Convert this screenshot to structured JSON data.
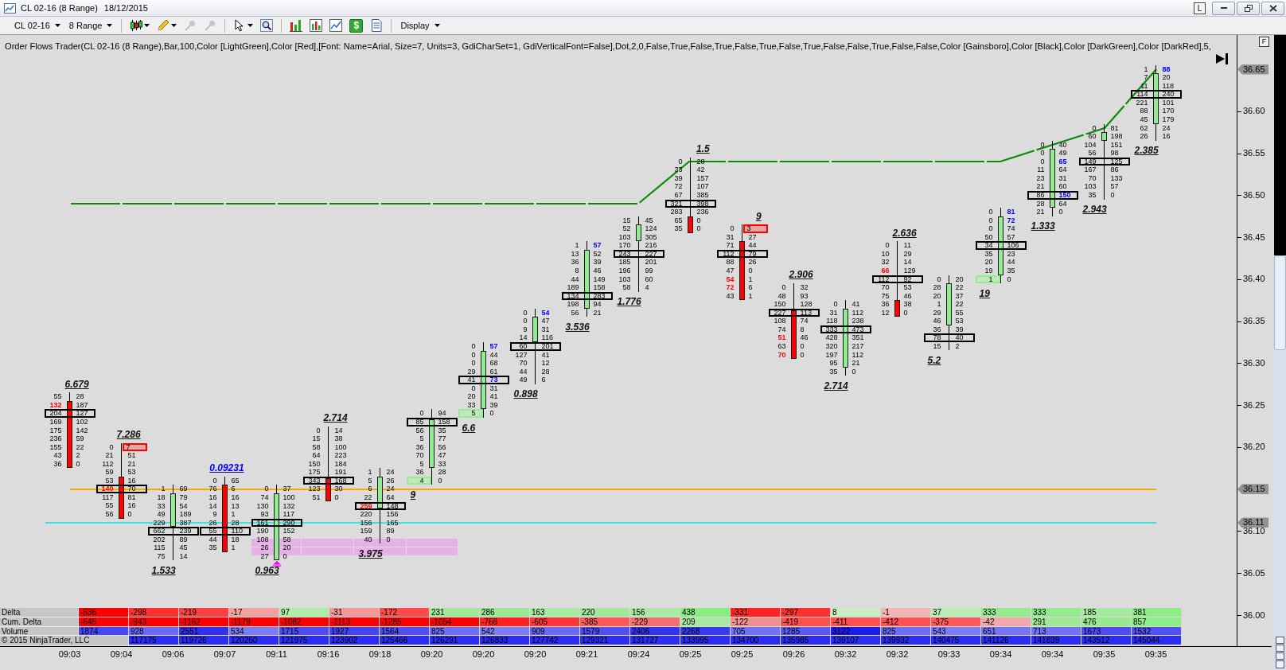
{
  "window": {
    "title": "CL 02-16 (8 Range)",
    "date": "18/12/2015",
    "link_button": "L"
  },
  "toolbar": {
    "instrument": "CL 02-16",
    "period": "8 Range",
    "glyph_button": "$",
    "menu": "Display"
  },
  "indicator": "Order Flows Trader(CL 02-16 (8 Range),Bar,100,Color [LightGreen],Color [Red],[Font: Name=Arial, Size=7, Units=3, GdiCharSet=1, GdiVerticalFont=False],Dot,2,0,False,True,False,True,False,True,False,True,False,False,True,False,False,Color [Gainsboro],Color [Black],Color [DarkGreen],Color [DarkRed],5,",
  "panel_button": "F",
  "bars": [
    {
      "kind": "down",
      "ratio": "6.679",
      "ratio_highlighted": false,
      "marker": false,
      "rows": [
        {
          "bid": "55",
          "ask": "28",
          "kind": "plain",
          "poc": false,
          "body": false
        },
        {
          "bid": "132",
          "ask": "187",
          "kind": "bidimbalance",
          "poc": false,
          "body": true
        },
        {
          "bid": "204",
          "ask": "127",
          "kind": "plain",
          "poc": true,
          "body": true
        },
        {
          "bid": "169",
          "ask": "102",
          "kind": "plain",
          "poc": false,
          "body": true
        },
        {
          "bid": "175",
          "ask": "142",
          "kind": "plain",
          "poc": false,
          "body": true
        },
        {
          "bid": "236",
          "ask": "59",
          "kind": "plain",
          "poc": false,
          "body": true
        },
        {
          "bid": "155",
          "ask": "22",
          "kind": "plain",
          "poc": false,
          "body": true
        },
        {
          "bid": "43",
          "ask": "2",
          "kind": "plain",
          "poc": false,
          "body": true
        },
        {
          "bid": "36",
          "ask": "0",
          "kind": "plain",
          "poc": false,
          "body": true
        }
      ]
    },
    {
      "kind": "down",
      "ratio": "7.286",
      "ratio_highlighted": false,
      "marker": false,
      "rows": [
        {
          "bid": "0",
          "ask": "7",
          "kind": "askbox",
          "poc": false,
          "body": false
        },
        {
          "bid": "21",
          "ask": "51",
          "kind": "plain",
          "poc": false,
          "body": false
        },
        {
          "bid": "112",
          "ask": "21",
          "kind": "plain",
          "poc": false,
          "body": false
        },
        {
          "bid": "59",
          "ask": "53",
          "kind": "plain",
          "poc": false,
          "body": false
        },
        {
          "bid": "53",
          "ask": "16",
          "kind": "plain",
          "poc": false,
          "body": true
        },
        {
          "bid": "140",
          "ask": "70",
          "kind": "bidimbalance",
          "poc": true,
          "body": true
        },
        {
          "bid": "117",
          "ask": "81",
          "kind": "plain",
          "poc": false,
          "body": true
        },
        {
          "bid": "55",
          "ask": "16",
          "kind": "plain",
          "poc": false,
          "body": true
        },
        {
          "bid": "56",
          "ask": "0",
          "kind": "plain",
          "poc": false,
          "body": true
        }
      ]
    },
    {
      "kind": "up",
      "ratio": "1.533",
      "ratio_highlighted": false,
      "marker": false,
      "rows": [
        {
          "bid": "1",
          "ask": "69",
          "kind": "plain",
          "poc": false,
          "body": false
        },
        {
          "bid": "18",
          "ask": "79",
          "kind": "plain",
          "poc": false,
          "body": true
        },
        {
          "bid": "33",
          "ask": "54",
          "kind": "plain",
          "poc": false,
          "body": true
        },
        {
          "bid": "49",
          "ask": "189",
          "kind": "plain",
          "poc": false,
          "body": true
        },
        {
          "bid": "229",
          "ask": "387",
          "kind": "plain",
          "poc": false,
          "body": true
        },
        {
          "bid": "662",
          "ask": "239",
          "kind": "plain",
          "poc": true,
          "body": false
        },
        {
          "bid": "202",
          "ask": "89",
          "kind": "plain",
          "poc": false,
          "body": false
        },
        {
          "bid": "115",
          "ask": "45",
          "kind": "plain",
          "poc": false,
          "body": false
        },
        {
          "bid": "75",
          "ask": "14",
          "kind": "plain",
          "poc": false,
          "body": false
        }
      ]
    },
    {
      "kind": "down",
      "ratio": "0.09231",
      "ratio_highlighted": true,
      "marker": false,
      "rows": [
        {
          "bid": "0",
          "ask": "65",
          "kind": "plain",
          "poc": false,
          "body": false
        },
        {
          "bid": "76",
          "ask": "6",
          "kind": "plain",
          "poc": false,
          "body": true
        },
        {
          "bid": "16",
          "ask": "16",
          "kind": "plain",
          "poc": false,
          "body": true
        },
        {
          "bid": "14",
          "ask": "13",
          "kind": "plain",
          "poc": false,
          "body": true
        },
        {
          "bid": "9",
          "ask": "1",
          "kind": "plain",
          "poc": false,
          "body": true
        },
        {
          "bid": "26",
          "ask": "28",
          "kind": "plain",
          "poc": false,
          "body": true
        },
        {
          "bid": "55",
          "ask": "110",
          "kind": "plain",
          "poc": true,
          "body": true
        },
        {
          "bid": "44",
          "ask": "18",
          "kind": "plain",
          "poc": false,
          "body": true
        },
        {
          "bid": "35",
          "ask": "1",
          "kind": "plain",
          "poc": false,
          "body": true
        }
      ]
    },
    {
      "kind": "up",
      "ratio": "0.963",
      "ratio_highlighted": false,
      "marker": true,
      "rows": [
        {
          "bid": "0",
          "ask": "37",
          "kind": "plain",
          "poc": false,
          "body": false
        },
        {
          "bid": "74",
          "ask": "100",
          "kind": "plain",
          "poc": false,
          "body": true
        },
        {
          "bid": "130",
          "ask": "132",
          "kind": "plain",
          "poc": false,
          "body": true
        },
        {
          "bid": "93",
          "ask": "117",
          "kind": "plain",
          "poc": false,
          "body": true
        },
        {
          "bid": "161",
          "ask": "290",
          "kind": "plain",
          "poc": true,
          "body": true
        },
        {
          "bid": "190",
          "ask": "152",
          "kind": "plain",
          "poc": false,
          "body": true
        },
        {
          "bid": "108",
          "ask": "58",
          "kind": "plain",
          "poc": false,
          "body": true
        },
        {
          "bid": "26",
          "ask": "20",
          "kind": "plain",
          "poc": false,
          "body": true
        },
        {
          "bid": "27",
          "ask": "0",
          "kind": "plain",
          "poc": false,
          "body": true
        }
      ]
    },
    {
      "kind": "down",
      "ratio": "2.714",
      "ratio_highlighted": false,
      "marker": false,
      "rows": [
        {
          "bid": "0",
          "ask": "14",
          "kind": "plain",
          "poc": false,
          "body": false
        },
        {
          "bid": "15",
          "ask": "38",
          "kind": "plain",
          "poc": false,
          "body": false
        },
        {
          "bid": "58",
          "ask": "100",
          "kind": "plain",
          "poc": false,
          "body": false
        },
        {
          "bid": "64",
          "ask": "223",
          "kind": "plain",
          "poc": false,
          "body": false
        },
        {
          "bid": "150",
          "ask": "184",
          "kind": "plain",
          "poc": false,
          "body": false
        },
        {
          "bid": "175",
          "ask": "191",
          "kind": "plain",
          "poc": false,
          "body": false
        },
        {
          "bid": "343",
          "ask": "168",
          "kind": "plain",
          "poc": true,
          "body": true
        },
        {
          "bid": "123",
          "ask": "30",
          "kind": "plain",
          "poc": false,
          "body": true
        },
        {
          "bid": "51",
          "ask": "0",
          "kind": "plain",
          "poc": false,
          "body": true
        }
      ]
    },
    {
      "kind": "up",
      "ratio": "3.975",
      "ratio_highlighted": false,
      "marker": false,
      "rows": [
        {
          "bid": "1",
          "ask": "24",
          "kind": "plain",
          "poc": false,
          "body": false
        },
        {
          "bid": "5",
          "ask": "26",
          "kind": "plain",
          "poc": false,
          "body": true
        },
        {
          "bid": "6",
          "ask": "24",
          "kind": "plain",
          "poc": false,
          "body": true
        },
        {
          "bid": "22",
          "ask": "64",
          "kind": "plain",
          "poc": false,
          "body": true
        },
        {
          "bid": "259",
          "ask": "148",
          "kind": "bidimbalance",
          "poc": true,
          "body": true
        },
        {
          "bid": "220",
          "ask": "156",
          "kind": "plain",
          "poc": false,
          "body": false
        },
        {
          "bid": "156",
          "ask": "165",
          "kind": "plain",
          "poc": false,
          "body": false
        },
        {
          "bid": "159",
          "ask": "89",
          "kind": "plain",
          "poc": false,
          "body": false
        },
        {
          "bid": "40",
          "ask": "0",
          "kind": "plain",
          "poc": false,
          "body": false
        }
      ]
    },
    {
      "kind": "up",
      "ratio": "9",
      "ratio_highlighted": false,
      "marker": false,
      "rows": [
        {
          "bid": "0",
          "ask": "94",
          "kind": "plain",
          "poc": false,
          "body": false
        },
        {
          "bid": "85",
          "ask": "158",
          "kind": "plain",
          "poc": true,
          "body": true
        },
        {
          "bid": "56",
          "ask": "35",
          "kind": "plain",
          "poc": false,
          "body": true
        },
        {
          "bid": "5",
          "ask": "77",
          "kind": "plain",
          "poc": false,
          "body": true
        },
        {
          "bid": "36",
          "ask": "56",
          "kind": "plain",
          "poc": false,
          "body": true
        },
        {
          "bid": "70",
          "ask": "47",
          "kind": "plain",
          "poc": false,
          "body": true
        },
        {
          "bid": "5",
          "ask": "33",
          "kind": "plain",
          "poc": false,
          "body": true
        },
        {
          "bid": "36",
          "ask": "28",
          "kind": "plain",
          "poc": false,
          "body": false
        },
        {
          "bid": "4",
          "ask": "0",
          "kind": "bidbox",
          "poc": false,
          "body": false
        }
      ]
    },
    {
      "kind": "up",
      "ratio": "6.6",
      "ratio_highlighted": false,
      "marker": false,
      "rows": [
        {
          "bid": "0",
          "ask": "57",
          "kind": "askimbalance",
          "poc": false,
          "body": false
        },
        {
          "bid": "0",
          "ask": "44",
          "kind": "plain",
          "poc": false,
          "body": true
        },
        {
          "bid": "0",
          "ask": "68",
          "kind": "plain",
          "poc": false,
          "body": true
        },
        {
          "bid": "29",
          "ask": "61",
          "kind": "plain",
          "poc": false,
          "body": true
        },
        {
          "bid": "41",
          "ask": "73",
          "kind": "askimbalance",
          "poc": true,
          "body": true
        },
        {
          "bid": "0",
          "ask": "31",
          "kind": "plain",
          "poc": false,
          "body": true
        },
        {
          "bid": "20",
          "ask": "41",
          "kind": "plain",
          "poc": false,
          "body": true
        },
        {
          "bid": "33",
          "ask": "39",
          "kind": "plain",
          "poc": false,
          "body": true
        },
        {
          "bid": "5",
          "ask": "0",
          "kind": "bidbox",
          "poc": false,
          "body": false
        }
      ]
    },
    {
      "kind": "up",
      "ratio": "0.898",
      "ratio_highlighted": false,
      "marker": false,
      "rows": [
        {
          "bid": "0",
          "ask": "54",
          "kind": "askimbalance",
          "poc": false,
          "body": false
        },
        {
          "bid": "0",
          "ask": "47",
          "kind": "plain",
          "poc": false,
          "body": true
        },
        {
          "bid": "9",
          "ask": "31",
          "kind": "plain",
          "poc": false,
          "body": true
        },
        {
          "bid": "14",
          "ask": "116",
          "kind": "plain",
          "poc": false,
          "body": true
        },
        {
          "bid": "60",
          "ask": "201",
          "kind": "plain",
          "poc": true,
          "body": false
        },
        {
          "bid": "127",
          "ask": "41",
          "kind": "plain",
          "poc": false,
          "body": false
        },
        {
          "bid": "70",
          "ask": "12",
          "kind": "plain",
          "poc": false,
          "body": false
        },
        {
          "bid": "44",
          "ask": "28",
          "kind": "plain",
          "poc": false,
          "body": false
        },
        {
          "bid": "49",
          "ask": "6",
          "kind": "plain",
          "poc": false,
          "body": false
        }
      ]
    },
    {
      "kind": "up",
      "ratio": "3.536",
      "ratio_highlighted": false,
      "marker": false,
      "rows": [
        {
          "bid": "1",
          "ask": "57",
          "kind": "askimbalance",
          "poc": false,
          "body": false
        },
        {
          "bid": "13",
          "ask": "52",
          "kind": "plain",
          "poc": false,
          "body": true
        },
        {
          "bid": "36",
          "ask": "39",
          "kind": "plain",
          "poc": false,
          "body": true
        },
        {
          "bid": "8",
          "ask": "46",
          "kind": "plain",
          "poc": false,
          "body": true
        },
        {
          "bid": "44",
          "ask": "149",
          "kind": "plain",
          "poc": false,
          "body": true
        },
        {
          "bid": "189",
          "ask": "158",
          "kind": "plain",
          "poc": false,
          "body": true
        },
        {
          "bid": "134",
          "ask": "283",
          "kind": "plain",
          "poc": true,
          "body": true
        },
        {
          "bid": "198",
          "ask": "94",
          "kind": "plain",
          "poc": false,
          "body": true
        },
        {
          "bid": "56",
          "ask": "21",
          "kind": "plain",
          "poc": false,
          "body": false
        }
      ]
    },
    {
      "kind": "up",
      "ratio": "1.776",
      "ratio_highlighted": false,
      "marker": false,
      "rows": [
        {
          "bid": "15",
          "ask": "45",
          "kind": "plain",
          "poc": false,
          "body": false
        },
        {
          "bid": "52",
          "ask": "124",
          "kind": "plain",
          "poc": false,
          "body": true
        },
        {
          "bid": "103",
          "ask": "305",
          "kind": "plain",
          "poc": false,
          "body": true
        },
        {
          "bid": "170",
          "ask": "216",
          "kind": "plain",
          "poc": false,
          "body": false
        },
        {
          "bid": "243",
          "ask": "227",
          "kind": "plain",
          "poc": true,
          "body": false
        },
        {
          "bid": "185",
          "ask": "201",
          "kind": "plain",
          "poc": false,
          "body": false
        },
        {
          "bid": "196",
          "ask": "99",
          "kind": "plain",
          "poc": false,
          "body": false
        },
        {
          "bid": "103",
          "ask": "60",
          "kind": "plain",
          "poc": false,
          "body": false
        },
        {
          "bid": "58",
          "ask": "4",
          "kind": "plain",
          "poc": false,
          "body": false
        }
      ]
    },
    {
      "kind": "down",
      "ratio": "1.5",
      "ratio_highlighted": false,
      "marker": false,
      "rows": [
        {
          "bid": "0",
          "ask": "28",
          "kind": "plain",
          "poc": false,
          "body": false
        },
        {
          "bid": "33",
          "ask": "42",
          "kind": "plain",
          "poc": false,
          "body": false
        },
        {
          "bid": "39",
          "ask": "157",
          "kind": "plain",
          "poc": false,
          "body": false
        },
        {
          "bid": "72",
          "ask": "107",
          "kind": "plain",
          "poc": false,
          "body": false
        },
        {
          "bid": "67",
          "ask": "385",
          "kind": "plain",
          "poc": false,
          "body": false
        },
        {
          "bid": "321",
          "ask": "398",
          "kind": "plain",
          "poc": true,
          "body": false
        },
        {
          "bid": "283",
          "ask": "236",
          "kind": "plain",
          "poc": false,
          "body": false
        },
        {
          "bid": "65",
          "ask": "0",
          "kind": "plain",
          "poc": false,
          "body": true
        },
        {
          "bid": "35",
          "ask": "0",
          "kind": "plain",
          "poc": false,
          "body": true
        }
      ]
    },
    {
      "kind": "down",
      "ratio": "9",
      "ratio_highlighted": false,
      "marker": false,
      "rows": [
        {
          "bid": "0",
          "ask": "3",
          "kind": "askbox",
          "poc": false,
          "body": false
        },
        {
          "bid": "31",
          "ask": "27",
          "kind": "plain",
          "poc": false,
          "body": false
        },
        {
          "bid": "71",
          "ask": "44",
          "kind": "plain",
          "poc": false,
          "body": true
        },
        {
          "bid": "112",
          "ask": "79",
          "kind": "plain",
          "poc": true,
          "body": true
        },
        {
          "bid": "88",
          "ask": "26",
          "kind": "plain",
          "poc": false,
          "body": true
        },
        {
          "bid": "47",
          "ask": "0",
          "kind": "plain",
          "poc": false,
          "body": true
        },
        {
          "bid": "54",
          "ask": "1",
          "kind": "bidimbalance",
          "poc": false,
          "body": true
        },
        {
          "bid": "72",
          "ask": "6",
          "kind": "bidimbalance",
          "poc": false,
          "body": true
        },
        {
          "bid": "43",
          "ask": "1",
          "kind": "plain",
          "poc": false,
          "body": true
        }
      ]
    },
    {
      "kind": "down",
      "ratio": "2.906",
      "ratio_highlighted": false,
      "marker": false,
      "rows": [
        {
          "bid": "0",
          "ask": "32",
          "kind": "plain",
          "poc": false,
          "body": false
        },
        {
          "bid": "48",
          "ask": "93",
          "kind": "plain",
          "poc": false,
          "body": false
        },
        {
          "bid": "150",
          "ask": "128",
          "kind": "plain",
          "poc": false,
          "body": false
        },
        {
          "bid": "227",
          "ask": "113",
          "kind": "plain",
          "poc": true,
          "body": true
        },
        {
          "bid": "108",
          "ask": "74",
          "kind": "plain",
          "poc": false,
          "body": true
        },
        {
          "bid": "74",
          "ask": "8",
          "kind": "plain",
          "poc": false,
          "body": true
        },
        {
          "bid": "51",
          "ask": "46",
          "kind": "bidimbalance",
          "poc": false,
          "body": true
        },
        {
          "bid": "63",
          "ask": "0",
          "kind": "plain",
          "poc": false,
          "body": true
        },
        {
          "bid": "70",
          "ask": "0",
          "kind": "bidimbalance",
          "poc": false,
          "body": true
        }
      ]
    },
    {
      "kind": "up",
      "ratio": "2.714",
      "ratio_highlighted": false,
      "marker": false,
      "rows": [
        {
          "bid": "0",
          "ask": "41",
          "kind": "plain",
          "poc": false,
          "body": false
        },
        {
          "bid": "31",
          "ask": "112",
          "kind": "plain",
          "poc": false,
          "body": true
        },
        {
          "bid": "118",
          "ask": "238",
          "kind": "plain",
          "poc": false,
          "body": true
        },
        {
          "bid": "333",
          "ask": "473",
          "kind": "plain",
          "poc": true,
          "body": true
        },
        {
          "bid": "428",
          "ask": "351",
          "kind": "plain",
          "poc": false,
          "body": true
        },
        {
          "bid": "320",
          "ask": "217",
          "kind": "plain",
          "poc": false,
          "body": true
        },
        {
          "bid": "197",
          "ask": "112",
          "kind": "plain",
          "poc": false,
          "body": true
        },
        {
          "bid": "95",
          "ask": "21",
          "kind": "plain",
          "poc": false,
          "body": true
        },
        {
          "bid": "35",
          "ask": "0",
          "kind": "plain",
          "poc": false,
          "body": false
        }
      ]
    },
    {
      "kind": "down",
      "ratio": "2.636",
      "ratio_highlighted": false,
      "marker": false,
      "rows": [
        {
          "bid": "0",
          "ask": "11",
          "kind": "plain",
          "poc": false,
          "body": false
        },
        {
          "bid": "10",
          "ask": "29",
          "kind": "plain",
          "poc": false,
          "body": false
        },
        {
          "bid": "32",
          "ask": "14",
          "kind": "plain",
          "poc": false,
          "body": false
        },
        {
          "bid": "66",
          "ask": "129",
          "kind": "bidimbalance",
          "poc": false,
          "body": false
        },
        {
          "bid": "112",
          "ask": "92",
          "kind": "plain",
          "poc": true,
          "body": false
        },
        {
          "bid": "70",
          "ask": "53",
          "kind": "plain",
          "poc": false,
          "body": false
        },
        {
          "bid": "75",
          "ask": "46",
          "kind": "plain",
          "poc": false,
          "body": false
        },
        {
          "bid": "36",
          "ask": "38",
          "kind": "plain",
          "poc": false,
          "body": true
        },
        {
          "bid": "12",
          "ask": "0",
          "kind": "plain",
          "poc": false,
          "body": true
        }
      ]
    },
    {
      "kind": "up",
      "ratio": "5.2",
      "ratio_highlighted": false,
      "marker": false,
      "rows": [
        {
          "bid": "0",
          "ask": "20",
          "kind": "plain",
          "poc": false,
          "body": false
        },
        {
          "bid": "28",
          "ask": "22",
          "kind": "plain",
          "poc": false,
          "body": true
        },
        {
          "bid": "20",
          "ask": "37",
          "kind": "plain",
          "poc": false,
          "body": true
        },
        {
          "bid": "1",
          "ask": "22",
          "kind": "plain",
          "poc": false,
          "body": true
        },
        {
          "bid": "29",
          "ask": "55",
          "kind": "plain",
          "poc": false,
          "body": true
        },
        {
          "bid": "46",
          "ask": "53",
          "kind": "plain",
          "poc": false,
          "body": true
        },
        {
          "bid": "36",
          "ask": "39",
          "kind": "plain",
          "poc": false,
          "body": false
        },
        {
          "bid": "78",
          "ask": "40",
          "kind": "plain",
          "poc": true,
          "body": false
        },
        {
          "bid": "15",
          "ask": "2",
          "kind": "plain",
          "poc": false,
          "body": false
        }
      ]
    },
    {
      "kind": "up",
      "ratio": "19",
      "ratio_highlighted": false,
      "marker": false,
      "rows": [
        {
          "bid": "0",
          "ask": "81",
          "kind": "askimbalance",
          "poc": false,
          "body": false
        },
        {
          "bid": "0",
          "ask": "72",
          "kind": "askimbalance",
          "poc": false,
          "body": true
        },
        {
          "bid": "0",
          "ask": "74",
          "kind": "plain",
          "poc": false,
          "body": true
        },
        {
          "bid": "50",
          "ask": "57",
          "kind": "plain",
          "poc": false,
          "body": true
        },
        {
          "bid": "34",
          "ask": "106",
          "kind": "plain",
          "poc": true,
          "body": true
        },
        {
          "bid": "35",
          "ask": "23",
          "kind": "plain",
          "poc": false,
          "body": true
        },
        {
          "bid": "20",
          "ask": "44",
          "kind": "plain",
          "poc": false,
          "body": true
        },
        {
          "bid": "19",
          "ask": "35",
          "kind": "plain",
          "poc": false,
          "body": true
        },
        {
          "bid": "1",
          "ask": "0",
          "kind": "bidbox",
          "poc": false,
          "body": false
        }
      ]
    },
    {
      "kind": "up",
      "ratio": "1.333",
      "ratio_highlighted": false,
      "marker": false,
      "rows": [
        {
          "bid": "0",
          "ask": "40",
          "kind": "plain",
          "poc": false,
          "body": false
        },
        {
          "bid": "0",
          "ask": "49",
          "kind": "plain",
          "poc": false,
          "body": true
        },
        {
          "bid": "0",
          "ask": "65",
          "kind": "askimbalance",
          "poc": false,
          "body": true
        },
        {
          "bid": "11",
          "ask": "64",
          "kind": "plain",
          "poc": false,
          "body": true
        },
        {
          "bid": "23",
          "ask": "31",
          "kind": "plain",
          "poc": false,
          "body": true
        },
        {
          "bid": "21",
          "ask": "60",
          "kind": "plain",
          "poc": false,
          "body": true
        },
        {
          "bid": "86",
          "ask": "150",
          "kind": "askimbalance",
          "poc": true,
          "body": true
        },
        {
          "bid": "28",
          "ask": "64",
          "kind": "plain",
          "poc": false,
          "body": true
        },
        {
          "bid": "21",
          "ask": "0",
          "kind": "plain",
          "poc": false,
          "body": false
        }
      ]
    },
    {
      "kind": "up",
      "ratio": "2.943",
      "ratio_highlighted": false,
      "marker": false,
      "rows": [
        {
          "bid": "0",
          "ask": "81",
          "kind": "plain",
          "poc": false,
          "body": false
        },
        {
          "bid": "60",
          "ask": "198",
          "kind": "plain",
          "poc": false,
          "body": true
        },
        {
          "bid": "104",
          "ask": "151",
          "kind": "plain",
          "poc": false,
          "body": false
        },
        {
          "bid": "56",
          "ask": "98",
          "kind": "plain",
          "poc": false,
          "body": false
        },
        {
          "bid": "149",
          "ask": "125",
          "kind": "plain",
          "poc": true,
          "body": false
        },
        {
          "bid": "167",
          "ask": "86",
          "kind": "plain",
          "poc": false,
          "body": false
        },
        {
          "bid": "70",
          "ask": "133",
          "kind": "plain",
          "poc": false,
          "body": false
        },
        {
          "bid": "103",
          "ask": "57",
          "kind": "plain",
          "poc": false,
          "body": false
        },
        {
          "bid": "35",
          "ask": "0",
          "kind": "plain",
          "poc": false,
          "body": false
        }
      ]
    },
    {
      "kind": "up",
      "ratio": "2.385",
      "ratio_highlighted": false,
      "marker": false,
      "rows": [
        {
          "bid": "1",
          "ask": "88",
          "kind": "askimbalance",
          "poc": false,
          "body": false
        },
        {
          "bid": "7",
          "ask": "20",
          "kind": "plain",
          "poc": false,
          "body": true
        },
        {
          "bid": "11",
          "ask": "118",
          "kind": "plain",
          "poc": false,
          "body": true
        },
        {
          "bid": "114",
          "ask": "240",
          "kind": "plain",
          "poc": true,
          "body": true
        },
        {
          "bid": "221",
          "ask": "101",
          "kind": "plain",
          "poc": false,
          "body": true
        },
        {
          "bid": "88",
          "ask": "170",
          "kind": "plain",
          "poc": false,
          "body": true
        },
        {
          "bid": "45",
          "ask": "179",
          "kind": "plain",
          "poc": false,
          "body": true
        },
        {
          "bid": "62",
          "ask": "24",
          "kind": "plain",
          "poc": false,
          "body": false
        },
        {
          "bid": "26",
          "ask": "16",
          "kind": "plain",
          "poc": false,
          "body": false
        }
      ]
    }
  ],
  "price_axis": {
    "labels": [
      "36.60",
      "36.55",
      "36.50",
      "36.45",
      "36.40",
      "36.35",
      "36.30",
      "36.25",
      "36.20",
      "36.10",
      "36.05",
      "36.00"
    ],
    "tags": [
      {
        "text": "36.65"
      },
      {
        "text": "36.15",
        "color": "#ffa500"
      },
      {
        "text": "36.11",
        "color": "#40e0e0"
      }
    ]
  },
  "table": {
    "rows": [
      {
        "label": "Delta",
        "cells": [
          {
            "text": "-536",
            "color": "#ff0000"
          },
          {
            "text": "-298",
            "color": "#ff3030"
          },
          {
            "text": "-219",
            "color": "#ff4040"
          },
          {
            "text": "-17",
            "color": "#f2a0a0"
          },
          {
            "text": "97",
            "color": "#b0eca8"
          },
          {
            "text": "-31",
            "color": "#f29898"
          },
          {
            "text": "-172",
            "color": "#ff4a4a"
          },
          {
            "text": "231",
            "color": "#a0e898"
          },
          {
            "text": "286",
            "color": "#9ae892"
          },
          {
            "text": "163",
            "color": "#a8eaa0"
          },
          {
            "text": "220",
            "color": "#a2e89a"
          },
          {
            "text": "156",
            "color": "#aaeaa2"
          },
          {
            "text": "438",
            "color": "#88ee80"
          },
          {
            "text": "-331",
            "color": "#ff2424"
          },
          {
            "text": "-297",
            "color": "#ff3030"
          },
          {
            "text": "8",
            "color": "#c8eec2"
          },
          {
            "text": "-1",
            "color": "#f2b4b4"
          },
          {
            "text": "37",
            "color": "#bcecb4"
          },
          {
            "text": "333",
            "color": "#94ea8c"
          },
          {
            "text": "333",
            "color": "#94ea8c"
          },
          {
            "text": "185",
            "color": "#a6eaa0"
          },
          {
            "text": "381",
            "color": "#90ec88"
          }
        ]
      },
      {
        "label": "Cum. Delta",
        "cells": [
          {
            "text": "-645",
            "color": "#ff0000"
          },
          {
            "text": "-943",
            "color": "#ff0000"
          },
          {
            "text": "-1162",
            "color": "#ff0000"
          },
          {
            "text": "-1179",
            "color": "#ff0000"
          },
          {
            "text": "-1082",
            "color": "#ff0000"
          },
          {
            "text": "-1113",
            "color": "#ff0000"
          },
          {
            "text": "-1285",
            "color": "#ff0000"
          },
          {
            "text": "-1054",
            "color": "#ff0000"
          },
          {
            "text": "-768",
            "color": "#ff2020"
          },
          {
            "text": "-605",
            "color": "#ff3434"
          },
          {
            "text": "-385",
            "color": "#ff5656"
          },
          {
            "text": "-229",
            "color": "#f47070"
          },
          {
            "text": "209",
            "color": "#a8eaa0"
          },
          {
            "text": "-122",
            "color": "#f09090"
          },
          {
            "text": "-419",
            "color": "#ff5050"
          },
          {
            "text": "-411",
            "color": "#ff5050"
          },
          {
            "text": "-412",
            "color": "#ff5050"
          },
          {
            "text": "-375",
            "color": "#ff5a5a"
          },
          {
            "text": "-42",
            "color": "#f2a8a8"
          },
          {
            "text": "291",
            "color": "#a0e898"
          },
          {
            "text": "476",
            "color": "#98ea90"
          },
          {
            "text": "857",
            "color": "#8cee84"
          }
        ]
      },
      {
        "label": "Volume",
        "cells": [
          {
            "text": "1874",
            "color": "#4848f0"
          },
          {
            "text": "928",
            "color": "#6a6af2"
          },
          {
            "text": "2551",
            "color": "#3030ee"
          },
          {
            "text": "534",
            "color": "#7c7cf4"
          },
          {
            "text": "1715",
            "color": "#4c4cf0"
          },
          {
            "text": "1927",
            "color": "#4444f0"
          },
          {
            "text": "1564",
            "color": "#5050f0"
          },
          {
            "text": "825",
            "color": "#6e6ef2"
          },
          {
            "text": "542",
            "color": "#7c7cf4"
          },
          {
            "text": "909",
            "color": "#6a6af2"
          },
          {
            "text": "1579",
            "color": "#5050f0"
          },
          {
            "text": "2406",
            "color": "#3434ee"
          },
          {
            "text": "2268",
            "color": "#3838ee"
          },
          {
            "text": "705",
            "color": "#7272f4"
          },
          {
            "text": "1285",
            "color": "#5a5af0"
          },
          {
            "text": "3122",
            "color": "#1c1cec"
          },
          {
            "text": "825",
            "color": "#6e6ef2"
          },
          {
            "text": "543",
            "color": "#7c7cf4"
          },
          {
            "text": "651",
            "color": "#7676f4"
          },
          {
            "text": "713",
            "color": "#7272f4"
          },
          {
            "text": "1673",
            "color": "#4c4cf0"
          },
          {
            "text": "1532",
            "color": "#5252f0"
          }
        ]
      }
    ],
    "copyright": "© 2015 NinjaTrader, LLC",
    "last_row": {
      "cells": [
        {
          "text": "117175"
        },
        {
          "text": "119726"
        },
        {
          "text": "120260"
        },
        {
          "text": "121975"
        },
        {
          "text": "123902"
        },
        {
          "text": "125466"
        },
        {
          "text": "126291"
        },
        {
          "text": "126833"
        },
        {
          "text": "127742"
        },
        {
          "text": "129321"
        },
        {
          "text": "131727"
        },
        {
          "text": "133995"
        },
        {
          "text": "134700"
        },
        {
          "text": "135985"
        },
        {
          "text": "139107"
        },
        {
          "text": "139932"
        },
        {
          "text": "140475"
        },
        {
          "text": "141126"
        },
        {
          "text": "141839"
        },
        {
          "text": "143512"
        },
        {
          "text": "145044"
        }
      ]
    }
  },
  "time_axis": [
    "09:03",
    "09:04",
    "09:06",
    "09:07",
    "09:11",
    "09:16",
    "09:18",
    "09:20",
    "09:20",
    "09:20",
    "09:21",
    "09:24",
    "09:25",
    "09:25",
    "09:26",
    "09:32",
    "09:32",
    "09:33",
    "09:34",
    "09:34",
    "09:35",
    "09:35"
  ]
}
